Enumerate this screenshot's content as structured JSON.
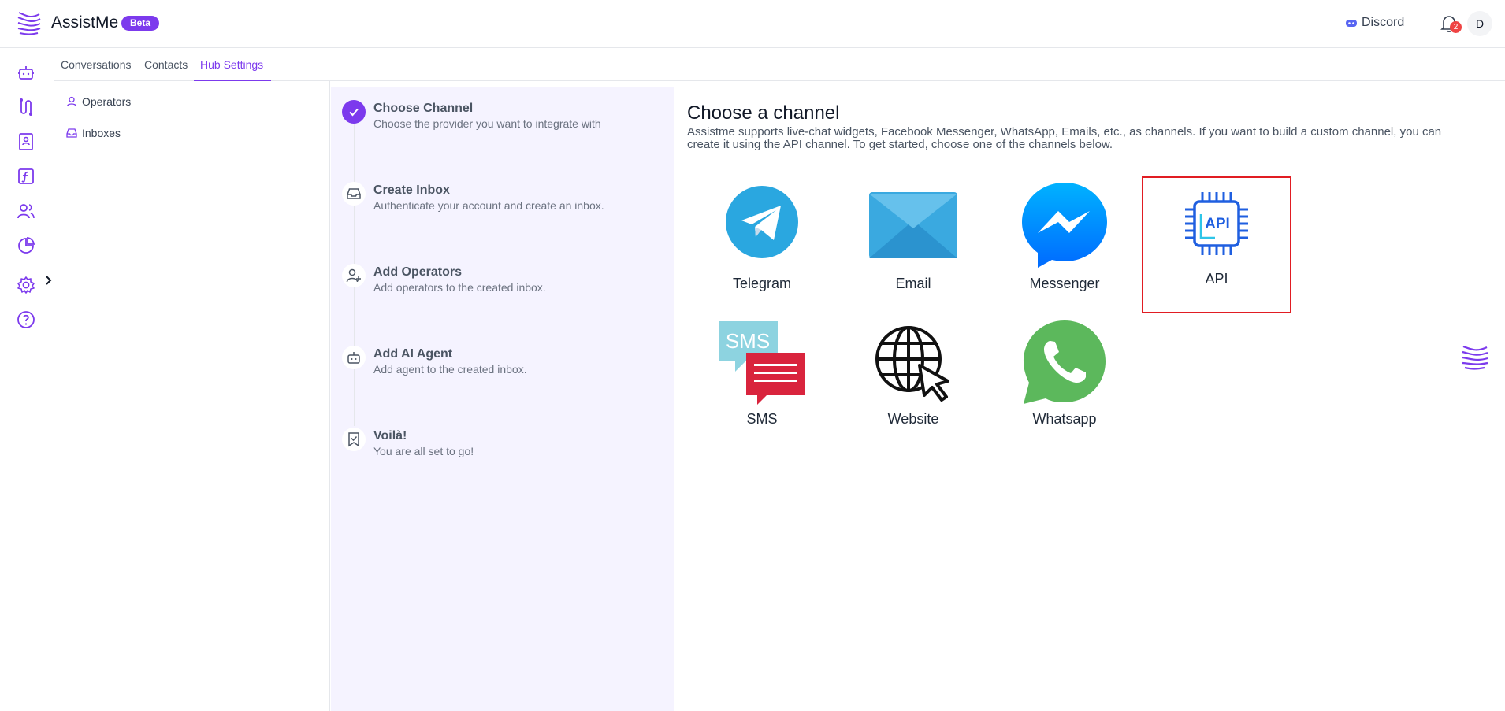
{
  "header": {
    "brand": "AssistMe",
    "badge": "Beta",
    "discord_label": "Discord",
    "notification_count": "2",
    "avatar_initial": "D"
  },
  "rail": {
    "icons": [
      "bot-icon",
      "flow-icon",
      "book-icon",
      "function-icon",
      "users-icon",
      "chart-icon",
      "settings-icon",
      "help-icon"
    ]
  },
  "tabs": [
    {
      "label": "Conversations"
    },
    {
      "label": "Contacts"
    },
    {
      "label": "Hub Settings",
      "active": true
    }
  ],
  "subnav": [
    {
      "label": "Operators",
      "icon": "user-icon"
    },
    {
      "label": "Inboxes",
      "icon": "inbox-icon"
    }
  ],
  "steps": [
    {
      "title": "Choose Channel",
      "desc": "Choose the provider you want to integrate with",
      "done": true
    },
    {
      "title": "Create Inbox",
      "desc": "Authenticate your account and create an inbox."
    },
    {
      "title": "Add Operators",
      "desc": "Add operators to the created inbox."
    },
    {
      "title": "Add AI Agent",
      "desc": "Add agent to the created inbox."
    },
    {
      "title": "Voilà!",
      "desc": "You are all set to go!"
    }
  ],
  "main": {
    "title": "Choose a channel",
    "description": "Assistme supports live-chat widgets, Facebook Messenger, WhatsApp, Emails, etc., as channels. If you want to build a custom channel, you can create it using the API channel. To get started, choose one of the channels below."
  },
  "channels": [
    {
      "label": "Telegram"
    },
    {
      "label": "Email"
    },
    {
      "label": "Messenger"
    },
    {
      "label": "API",
      "selected": true
    },
    {
      "label": "SMS",
      "icon_text": "SMS"
    },
    {
      "label": "Website"
    },
    {
      "label": "Whatsapp"
    }
  ],
  "api_icon_text": "API",
  "colors": {
    "accent": "#7c3aed",
    "selection_border": "#e11d23",
    "telegram": "#2aa7e0",
    "email": "#3aa9e0",
    "messenger": "#0a84ff",
    "api": "#1f5fe0",
    "sms_top": "#8dd3e0",
    "sms_bottom": "#d9243d",
    "whatsapp": "#5cb85c"
  }
}
